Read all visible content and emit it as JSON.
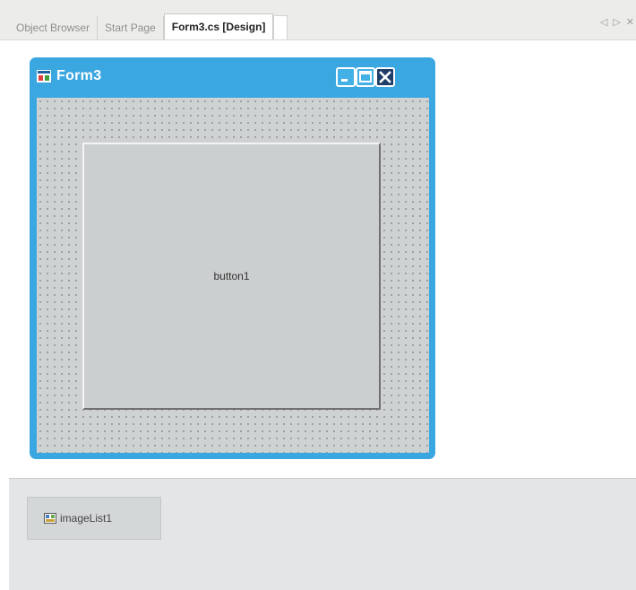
{
  "tabs": [
    {
      "label": "Object Browser",
      "active": false
    },
    {
      "label": "Start Page",
      "active": false
    },
    {
      "label": "Form3.cs [Design]",
      "active": true
    }
  ],
  "tab_controls": {
    "left": "◁",
    "right": "▷",
    "close": "✕"
  },
  "form": {
    "title": "Form3",
    "icon": "form-window-icon",
    "caption_buttons": [
      "minimize",
      "maximize",
      "close"
    ]
  },
  "controls": {
    "button1_label": "button1"
  },
  "tray": {
    "items": [
      {
        "label": "imageList1",
        "icon": "imagelist-icon"
      }
    ]
  },
  "colors": {
    "form_border": "#3ba7e0",
    "close_button": "#1f3d68",
    "client_background": "#cfd2d2"
  }
}
